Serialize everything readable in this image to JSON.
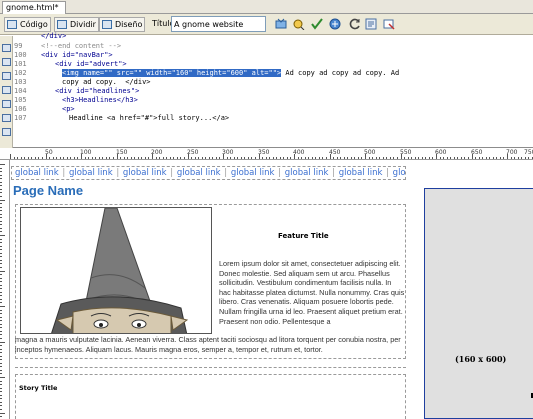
{
  "tab": {
    "filename": "gnome.html*"
  },
  "toolbar": {
    "code_label": "Código",
    "split_label": "Dividir",
    "design_label": "Diseño",
    "title_label": "Título:",
    "title_value": "A gnome website"
  },
  "code": {
    "lines": [
      {
        "num": "99",
        "text": "<!--end content -->"
      },
      {
        "num": "100",
        "text": "<div id=\"navBar\">"
      },
      {
        "num": "101",
        "text": "<div id=\"advert\">"
      },
      {
        "num": "102",
        "text_sel": "<img name=\"\" src=\"\" width=\"160\" height=\"600\" alt=\"\">",
        "text_after": " Ad copy ad copy ad copy. Ad"
      },
      {
        "num": "103",
        "text": "copy ad copy.  </div>"
      },
      {
        "num": "104",
        "text": "<div id=\"headlines\">"
      },
      {
        "num": "105",
        "text": "<h3>Headlines</h3>"
      },
      {
        "num": "106",
        "text": "<p>"
      },
      {
        "num": "107",
        "text": "Headline <a href=\"#\">full story...</a>"
      }
    ]
  },
  "ruler": {
    "marks": [
      "50",
      "100",
      "150",
      "200",
      "250",
      "300",
      "350",
      "400",
      "450",
      "500",
      "550",
      "600",
      "650",
      "700",
      "750"
    ]
  },
  "design": {
    "global_links": [
      "global link",
      "global link",
      "global link",
      "global link",
      "global link",
      "global link",
      "global link",
      "global link"
    ],
    "page_name": "Page Name",
    "feature_title": "Feature Title",
    "feature_text": "Lorem ipsum dolor sit amet, consectetuer adipiscing elit. Donec molestie. Sed aliquam sem ut arcu. Phasellus sollicitudin. Vestibulum condimentum facilisis nulla. In hac habitasse platea dictumst. Nulla nonummy. Cras quis libero. Cras venenatis. Aliquam posuere lobortis pede. Nullam fringilla urna id leo. Praesent aliquet pretium erat. Praesent non odio. Pellentesque a",
    "feature_wrap": "magna a mauris vulputate lacinia. Aenean viverra. Class aptent taciti sociosqu ad litora torquent per conubia nostra, per inceptos hymenaeos. Aliquam lacus. Mauris magna eros, semper a, tempor et, rutrum et, tortor.",
    "story_title": "Story Title",
    "advert_label": "(160 x 600)"
  },
  "colors": {
    "link": "#3b6fd0",
    "page_name": "#2a6db8",
    "selection": "#316ac5",
    "advert_bg": "#e0e0e0"
  }
}
